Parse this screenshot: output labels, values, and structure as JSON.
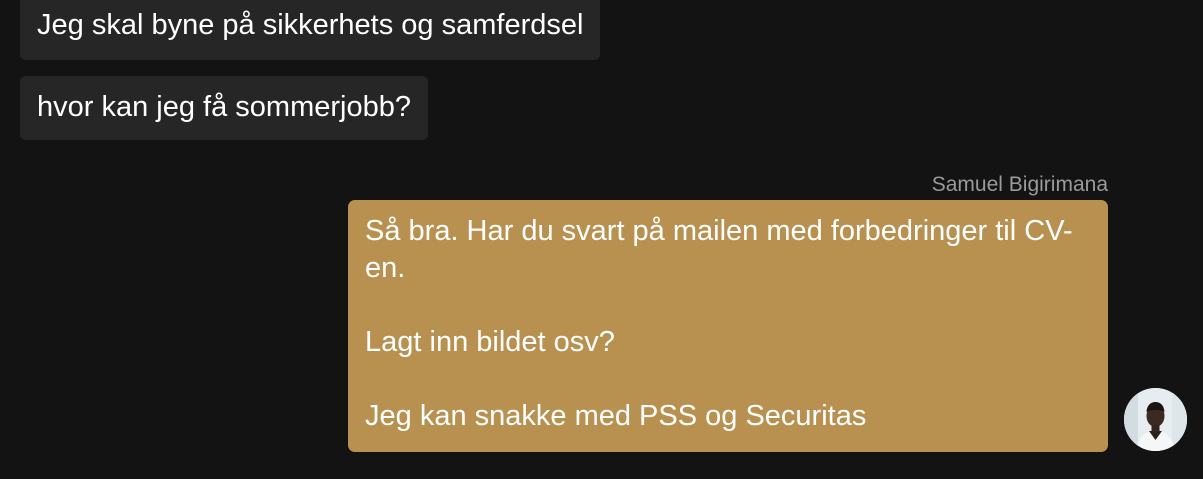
{
  "messages_incoming": [
    {
      "text": "Jeg skal byne på sikkerhets og samferdsel"
    },
    {
      "text": "hvor kan jeg få sommerjobb?"
    }
  ],
  "message_outgoing": {
    "sender": "Samuel Bigirimana",
    "paragraphs": [
      "Så bra. Har du svart på mailen med forbedringer til CV-en.",
      "Lagt inn bildet osv?",
      "Jeg kan snakke med PSS og Securitas"
    ],
    "bubble_color": "#b89150"
  },
  "avatar": {
    "icon": "user-photo-avatar"
  },
  "theme": {
    "background": "#131313",
    "incoming_bubble": "#262626"
  }
}
